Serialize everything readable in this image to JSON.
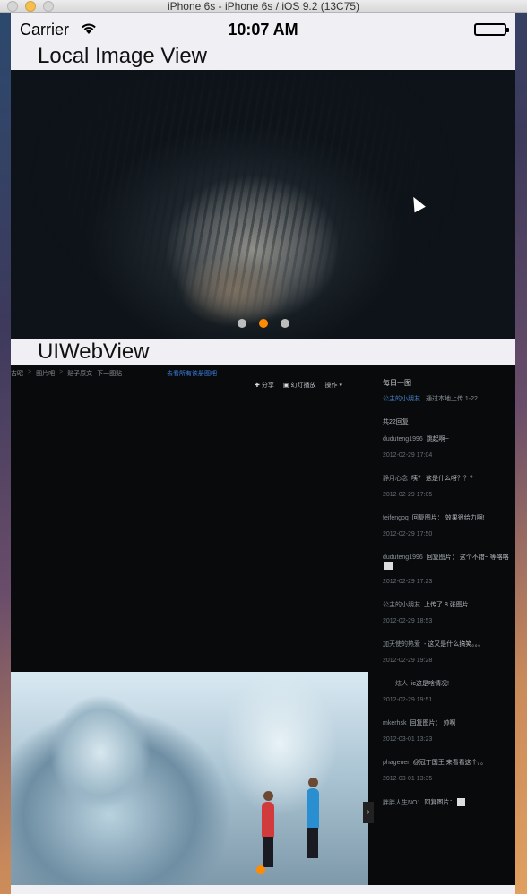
{
  "window": {
    "title": "iPhone 6s - iPhone 6s / iOS 9.2 (13C75)"
  },
  "statusbar": {
    "carrier": "Carrier",
    "time": "10:07 AM"
  },
  "sections": {
    "local_title": "Local Image View",
    "web_title": "UIWebView"
  },
  "image_view": {
    "page_count": 3,
    "current_page": 2
  },
  "web": {
    "breadcrumb": [
      "吉昭",
      "图片吧",
      "贴子原文",
      "下一图贴"
    ],
    "link": "去看所有该册图吧",
    "toolbar": {
      "share": "分享",
      "slideshow": "幻灯播放",
      "ops": "操作"
    },
    "sidebar": {
      "title": "每日一图",
      "meta_user": "公主的小朋友",
      "meta_text": "通过本地上传 1-22",
      "count": "共22回复",
      "comments": [
        {
          "name": "duduteng1996",
          "text": "跳起啊~",
          "time": "2012-02-29 17:04"
        },
        {
          "name": "静月心念",
          "text": "咦？ 这是什么呀？？？",
          "time": "2012-02-29 17:05"
        },
        {
          "name": "feifengoq",
          "text": "回复图片： 效果很给力啊!",
          "time": "2012-02-29 17:50"
        },
        {
          "name": "duduteng1996",
          "text": "回复图片： 这个不错~ 等咯咯",
          "time": "2012-02-29 17:23"
        },
        {
          "name": "公主的小朋友",
          "text": "上传了 8 张图片",
          "time": "2012-02-29 18:53"
        },
        {
          "name": "加天使的热爱",
          "text": "- 这又是什么搞笑。。。",
          "time": "2012-02-29 19:28"
        },
        {
          "name": "一一炫人",
          "text": "ic这是啥情况!",
          "time": "2012-02-29 19:51"
        },
        {
          "name": "mkerhsk",
          "text": "回复图片： 帅啊",
          "time": "2012-03-01 13:23"
        },
        {
          "name": "phagener",
          "text": "@冠丁国王 来看看这个。。",
          "time": "2012-03-01 13:35"
        },
        {
          "name": "胖胖人生NO1",
          "text": "回复图片：",
          "time": ""
        }
      ]
    }
  }
}
